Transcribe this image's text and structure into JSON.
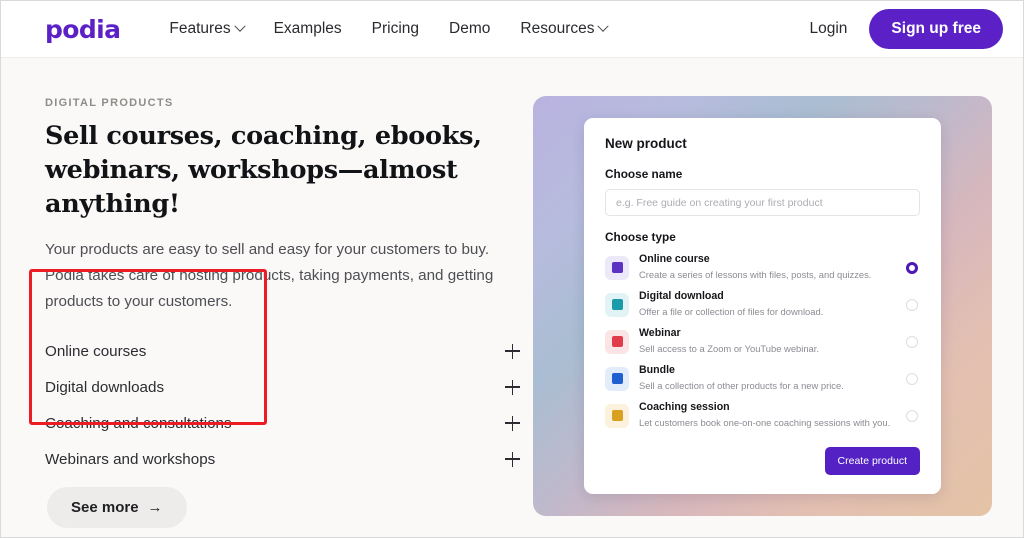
{
  "header": {
    "logo": "podia",
    "nav": [
      {
        "label": "Features",
        "has_caret": true
      },
      {
        "label": "Examples",
        "has_caret": false
      },
      {
        "label": "Pricing",
        "has_caret": false
      },
      {
        "label": "Demo",
        "has_caret": false
      },
      {
        "label": "Resources",
        "has_caret": true
      }
    ],
    "login_label": "Login",
    "signup_label": "Sign up free"
  },
  "hero": {
    "eyebrow": "DIGITAL PRODUCTS",
    "headline": "Sell courses, coaching, ebooks, webinars, workshops—almost anything!",
    "subcopy": "Your products are easy to sell and easy for your customers to buy. Podia takes care of hosting products, taking payments, and getting products to your customers.",
    "accordion": [
      {
        "label": "Online courses",
        "toggle": "plus-icon"
      },
      {
        "label": "Digital downloads",
        "toggle": "plus-icon"
      },
      {
        "label": "Coaching and consultations",
        "toggle": "plus-icon"
      },
      {
        "label": "Webinars and workshops",
        "toggle": "plus-icon"
      }
    ],
    "see_more_label": "See more",
    "see_more_arrow": "→"
  },
  "annotation": {
    "shape": "rectangle",
    "color": "#ec1c24",
    "surrounds": "accordion list labels"
  },
  "product_card": {
    "title": "New product",
    "name_field_label": "Choose name",
    "name_field_value": "",
    "name_field_placeholder": "e.g. Free guide on creating your first product",
    "type_field_label": "Choose type",
    "types": [
      {
        "name": "Online course",
        "description": "Create a series of lessons with files, posts, and quizzes.",
        "icon": "book-icon",
        "icon_color": "#5b32c2",
        "tile_color": "#ece9fa",
        "selected": true
      },
      {
        "name": "Digital download",
        "description": "Offer a file or collection of files for download.",
        "icon": "download-icon",
        "icon_color": "#1b9aaa",
        "tile_color": "#e2f3f5",
        "selected": false
      },
      {
        "name": "Webinar",
        "description": "Sell access to a Zoom or YouTube webinar.",
        "icon": "play-icon",
        "icon_color": "#e03b4a",
        "tile_color": "#fbe4e6",
        "selected": false
      },
      {
        "name": "Bundle",
        "description": "Sell a collection of other products for a new price.",
        "icon": "grid-icon",
        "icon_color": "#1f5fd0",
        "tile_color": "#e2ecfb",
        "selected": false
      },
      {
        "name": "Coaching session",
        "description": "Let customers book one-on-one coaching sessions with you.",
        "icon": "calendar-icon",
        "icon_color": "#d9a021",
        "tile_color": "#fbf1dc",
        "selected": false
      }
    ],
    "create_button_label": "Create product"
  },
  "theme": {
    "brand_purple": "#5b21c7",
    "page_background": "#faf9f7",
    "annotation_red": "#ec1c24"
  }
}
